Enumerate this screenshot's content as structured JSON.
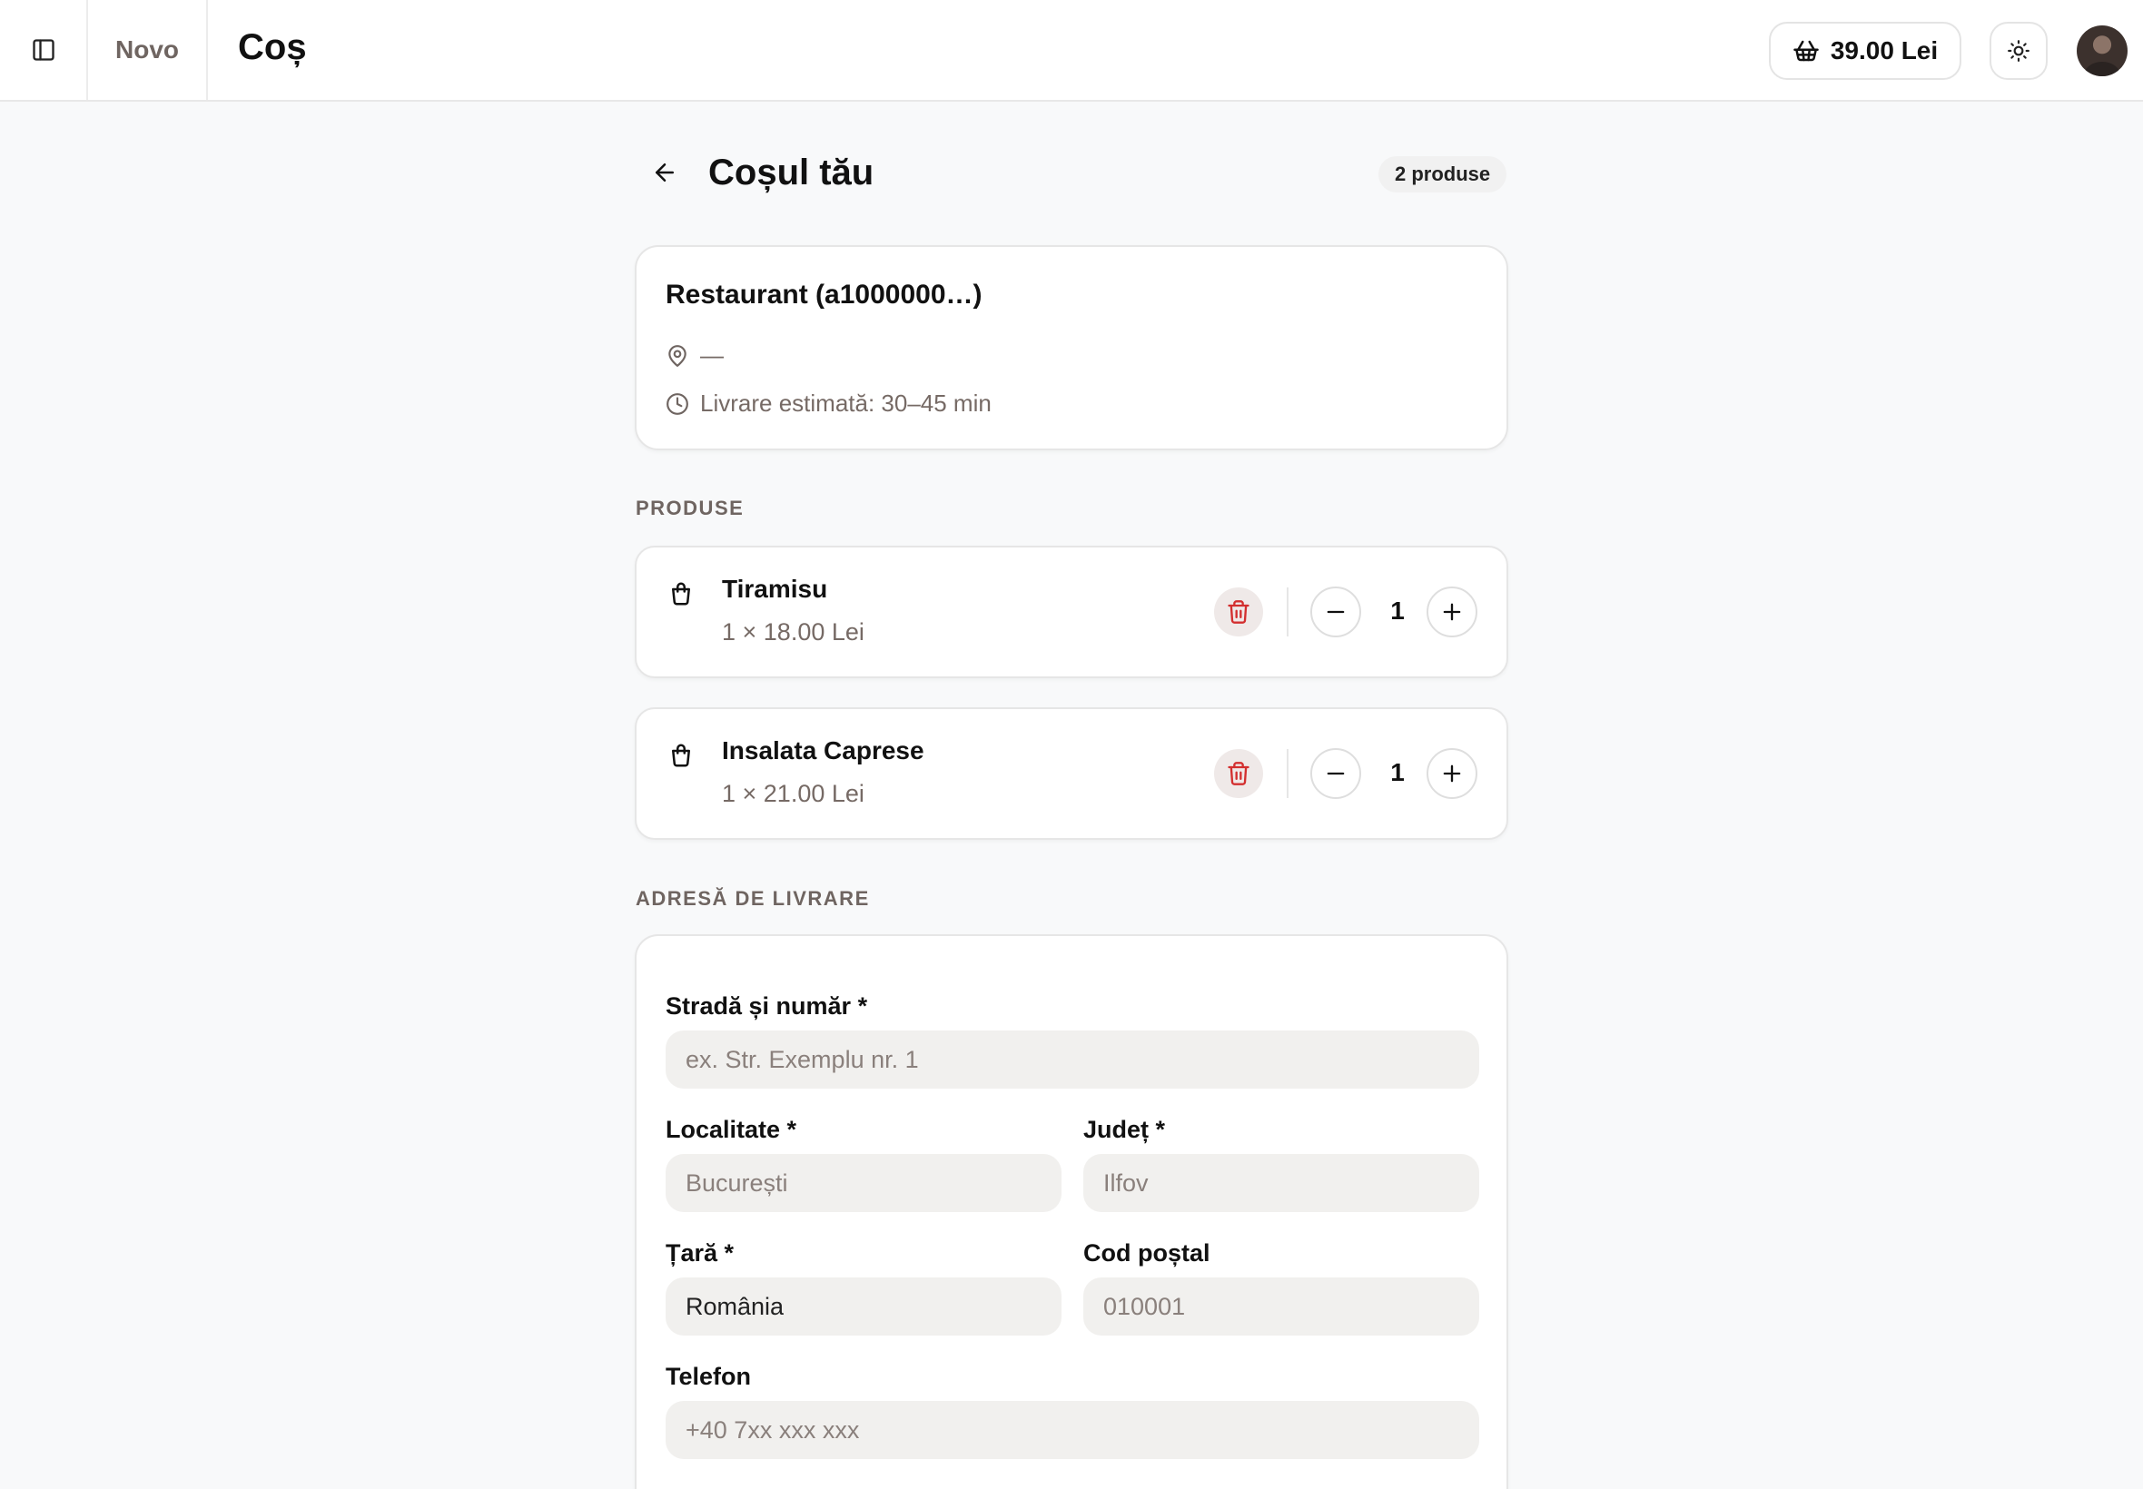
{
  "header": {
    "brand": "Novo",
    "title": "Coș",
    "cart_total": "39.00 Lei"
  },
  "cart": {
    "heading": "Coșul tău",
    "count_label": "2 produse"
  },
  "restaurant": {
    "name": "Restaurant (a1000000…)",
    "address": "—",
    "eta": "Livrare estimată: 30–45 min"
  },
  "products_section": {
    "label": "PRODUSE",
    "items": [
      {
        "name": "Tiramisu",
        "price": "1 × 18.00 Lei",
        "quantity": "1"
      },
      {
        "name": "Insalata Caprese",
        "price": "1 × 21.00 Lei",
        "quantity": "1"
      }
    ]
  },
  "address_section": {
    "label": "ADRESĂ DE LIVRARE",
    "street": {
      "label": "Stradă și număr *",
      "placeholder": "ex. Str. Exemplu nr. 1",
      "value": ""
    },
    "city": {
      "label": "Localitate *",
      "placeholder": "București",
      "value": ""
    },
    "county": {
      "label": "Județ *",
      "placeholder": "Ilfov",
      "value": ""
    },
    "country": {
      "label": "Țară *",
      "placeholder": "",
      "value": "România"
    },
    "postal": {
      "label": "Cod poștal",
      "placeholder": "010001",
      "value": ""
    },
    "phone": {
      "label": "Telefon",
      "placeholder": "+40 7xx xxx xxx",
      "value": ""
    }
  },
  "colors": {
    "accent_red": "#d32f2f",
    "muted_text": "#766a65",
    "input_bg": "#f1f0ee"
  }
}
